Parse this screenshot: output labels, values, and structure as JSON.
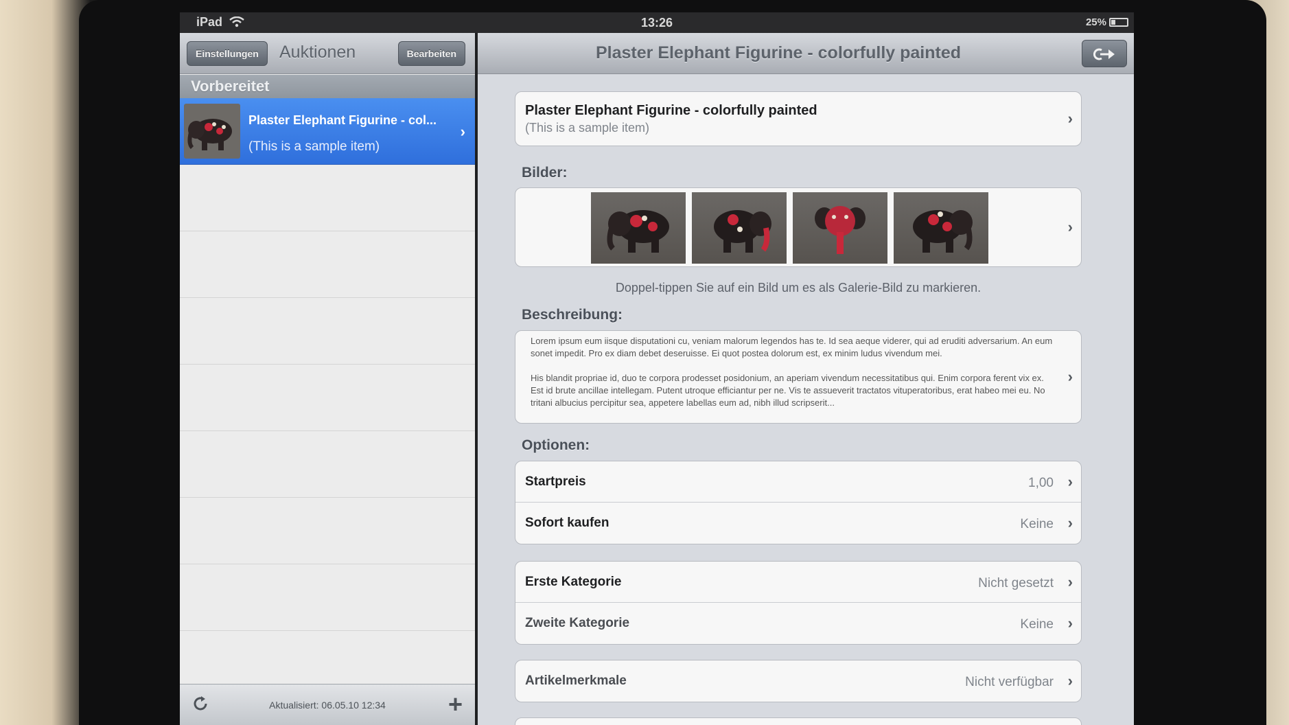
{
  "status_bar": {
    "device": "iPad",
    "time": "13:26",
    "battery": "25%"
  },
  "left_panel": {
    "settings_button": "Einstellungen",
    "title": "Auktionen",
    "edit_button": "Bearbeiten",
    "section_header": "Vorbereitet",
    "items": [
      {
        "title": "Plaster Elephant Figurine - col...",
        "subtitle": "(This is a sample item)"
      }
    ],
    "updated": "Aktualisiert: 06.05.10 12:34"
  },
  "detail": {
    "title": "Plaster Elephant Figurine - colorfully painted",
    "item_title": "Plaster Elephant Figurine - colorfully painted",
    "item_subtitle": "(This is a sample item)",
    "images_label": "Bilder:",
    "images_hint": "Doppel-tippen Sie auf ein Bild um es als Galerie-Bild zu markieren.",
    "description_label": "Beschreibung:",
    "description_p1": "Lorem ipsum eum iisque disputationi cu, veniam malorum legendos has te. Id sea aeque viderer, qui ad eruditi adversarium. An eum sonet impedit. Pro ex diam debet deseruisse. Ei quot postea dolorum est, ex minim ludus vivendum mei.",
    "description_p2": "His blandit propriae id, duo te corpora prodesset posidonium, an aperiam vivendum necessitatibus qui. Enim corpora ferent vix ex. Est id brute ancillae intellegam. Putent utroque efficiantur per ne. Vis te assueverit tractatos vituperatoribus, erat habeo mei eu. No tritani albucius percipitur sea, appetere labellas eum ad, nibh illud scripserit...",
    "options_label": "Optionen:",
    "options": [
      {
        "label": "Startpreis",
        "value": "1,00"
      },
      {
        "label": "Sofort kaufen",
        "value": "Keine"
      }
    ],
    "categories": [
      {
        "label": "Erste Kategorie",
        "value": "Nicht gesetzt"
      },
      {
        "label": "Zweite Kategorie",
        "value": "Keine"
      }
    ],
    "attributes": [
      {
        "label": "Artikelmerkmale",
        "value": "Nicht verfügbar"
      }
    ]
  },
  "colors": {
    "selection_blue": "#2f6fdc",
    "navbar_gray": "#a9adb4",
    "group_bg": "#d7dae0"
  }
}
